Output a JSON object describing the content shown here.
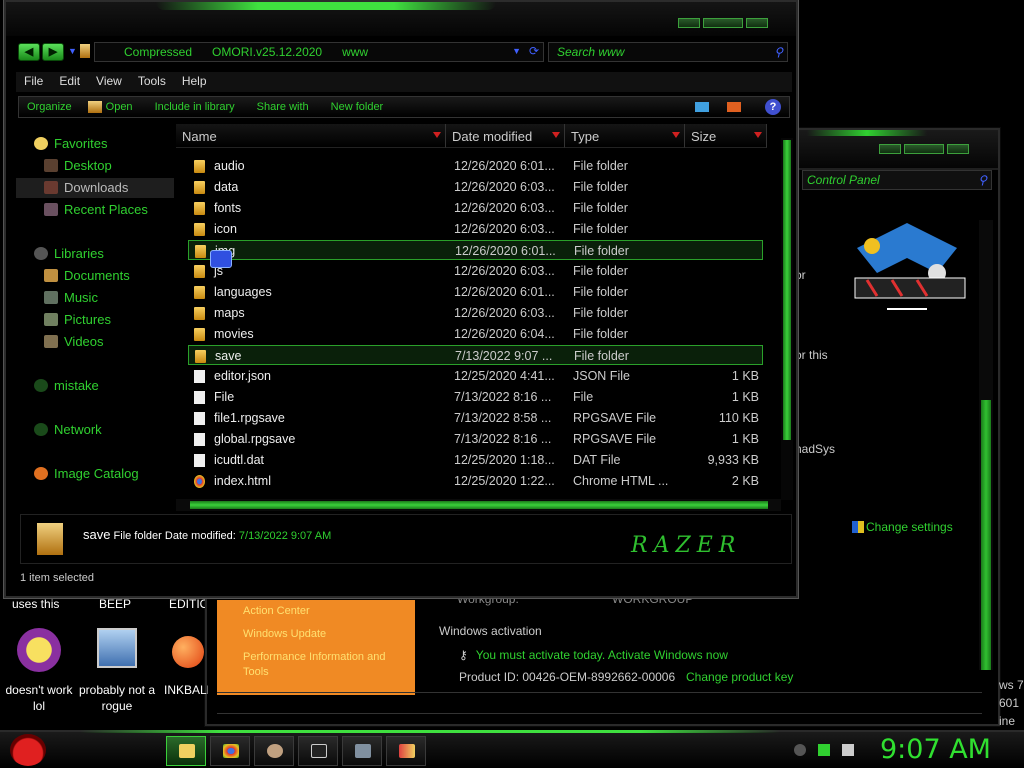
{
  "explorer": {
    "nav_back": "◀",
    "nav_forward": "▶",
    "address_segments": [
      "Compressed",
      "OMORI.v25.12.2020",
      "www"
    ],
    "search_placeholder": "Search www",
    "menu": [
      "File",
      "Edit",
      "View",
      "Tools",
      "Help"
    ],
    "commands": [
      "Organize",
      "Open",
      "Include in library",
      "Share with",
      "New folder"
    ],
    "help": "?",
    "sidebar": {
      "favorites": "Favorites",
      "fav_items": [
        "Desktop",
        "Downloads",
        "Recent Places"
      ],
      "libraries": "Libraries",
      "lib_items": [
        "Documents",
        "Music",
        "Pictures",
        "Videos"
      ],
      "mistake": "mistake",
      "network": "Network",
      "image_catalog": "Image Catalog"
    },
    "columns": [
      "Name",
      "Date modified",
      "Type",
      "Size"
    ],
    "rows": [
      {
        "name": "audio",
        "date": "12/26/2020 6:01...",
        "type": "File folder",
        "size": "",
        "kind": "folder"
      },
      {
        "name": "data",
        "date": "12/26/2020 6:03...",
        "type": "File folder",
        "size": "",
        "kind": "folder"
      },
      {
        "name": "fonts",
        "date": "12/26/2020 6:03...",
        "type": "File folder",
        "size": "",
        "kind": "folder"
      },
      {
        "name": "icon",
        "date": "12/26/2020 6:03...",
        "type": "File folder",
        "size": "",
        "kind": "folder"
      },
      {
        "name": "img",
        "date": "12/26/2020 6:01...",
        "type": "File folder",
        "size": "",
        "kind": "folder"
      },
      {
        "name": "js",
        "date": "12/26/2020 6:03...",
        "type": "File folder",
        "size": "",
        "kind": "folder"
      },
      {
        "name": "languages",
        "date": "12/26/2020 6:01...",
        "type": "File folder",
        "size": "",
        "kind": "folder"
      },
      {
        "name": "maps",
        "date": "12/26/2020 6:03...",
        "type": "File folder",
        "size": "",
        "kind": "folder"
      },
      {
        "name": "movies",
        "date": "12/26/2020 6:04...",
        "type": "File folder",
        "size": "",
        "kind": "folder"
      },
      {
        "name": "save",
        "date": "7/13/2022 9:07 ...",
        "type": "File folder",
        "size": "",
        "kind": "folder"
      },
      {
        "name": "editor.json",
        "date": "12/25/2020 4:41...",
        "type": "JSON File",
        "size": "1 KB",
        "kind": "file"
      },
      {
        "name": "File",
        "date": "7/13/2022 8:16 ...",
        "type": "File",
        "size": "1 KB",
        "kind": "file"
      },
      {
        "name": "file1.rpgsave",
        "date": "7/13/2022 8:58 ...",
        "type": "RPGSAVE File",
        "size": "110 KB",
        "kind": "file"
      },
      {
        "name": "global.rpgsave",
        "date": "7/13/2022 8:16 ...",
        "type": "RPGSAVE File",
        "size": "1 KB",
        "kind": "file"
      },
      {
        "name": "icudtl.dat",
        "date": "12/25/2020 1:18...",
        "type": "DAT File",
        "size": "9,933 KB",
        "kind": "file"
      },
      {
        "name": "index.html",
        "date": "12/25/2020 1:22...",
        "type": "Chrome HTML ...",
        "size": "2 KB",
        "kind": "chrome"
      }
    ],
    "details": {
      "name": "save",
      "type": "File folder",
      "date_label": "Date modified:",
      "date_value": "7/13/2022 9:07 AM",
      "brand": "RAZER"
    },
    "status": "1 item selected"
  },
  "control_panel": {
    "search_placeholder": "Control Panel",
    "text_or": "or",
    "text_or_this": "or this",
    "text_nadsys": "nadSys",
    "change_settings": "Change settings",
    "orange_links": [
      "Action Center",
      "Windows Update",
      "Performance Information and Tools"
    ],
    "partial_text": [
      "Workgroup:",
      "WORKGROUP"
    ],
    "activation_header": "Windows activation",
    "activation_msg": "You must activate today.  Activate Windows now",
    "product_id": "Product ID: 00426-OEM-8992662-00006",
    "change_key": "Change product key",
    "right_edge": [
      "ws 7",
      "601",
      "ine"
    ]
  },
  "desktop": {
    "labels_top": [
      "uses this",
      "BEEP",
      "EDITION"
    ],
    "icons": [
      {
        "label": "doesn't work lol",
        "icon": "yahoo-messenger-icon"
      },
      {
        "label": "probably not a rogue",
        "icon": "monitor-gears-icon"
      },
      {
        "label": "INKBALL",
        "icon": "inkball-icon"
      }
    ]
  },
  "taskbar": {
    "clock": "9:07 AM"
  },
  "colors": {
    "accent": "#30d030",
    "orange": "#f08a24"
  }
}
